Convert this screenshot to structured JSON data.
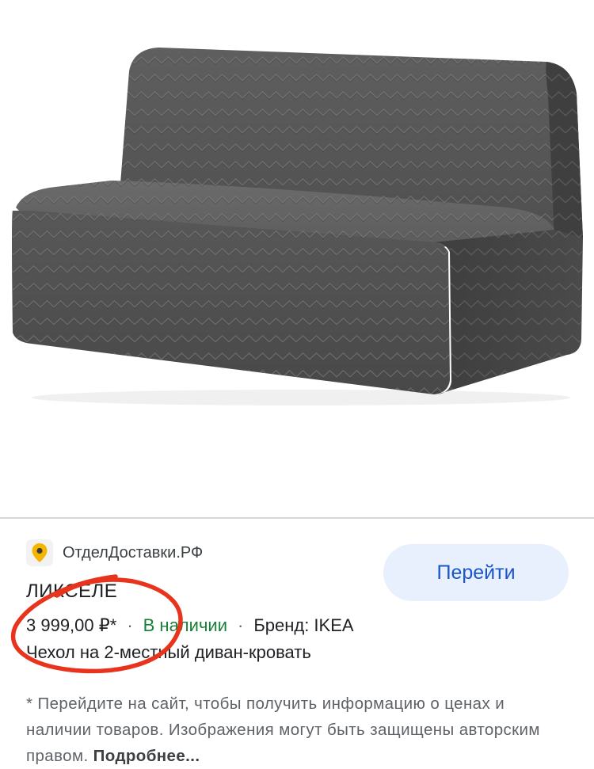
{
  "product_image": {
    "icon": "sofa-bed-image"
  },
  "merchant": {
    "icon": "map-pin-icon",
    "name": "ОтделДоставки.РФ"
  },
  "go_button": {
    "label": "Перейти"
  },
  "product": {
    "title": "ЛИКСЕЛЕ",
    "price": "3 999,00 ₽*",
    "stock": "В наличии",
    "brand": "Бренд: IKEA",
    "separator": "·",
    "description": "Чехол на 2-местный диван-кровать"
  },
  "disclaimer": {
    "text": "* Перейдите на сайт, чтобы получить информацию о ценах и наличии товаров. Изображения могут быть защищены авторским правом. ",
    "more_link": "Подробнее..."
  },
  "colors": {
    "accent": "#1a56c8",
    "button_bg": "#e8f0fe",
    "in_stock": "#188038",
    "annotation": "#e8341c"
  }
}
